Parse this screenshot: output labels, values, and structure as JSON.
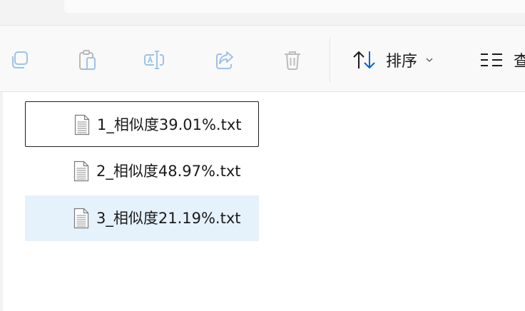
{
  "toolbar": {
    "buttons": [
      {
        "name": "copy-button",
        "icon": "copy-icon"
      },
      {
        "name": "paste-button",
        "icon": "paste-icon"
      },
      {
        "name": "rename-button",
        "icon": "rename-icon"
      },
      {
        "name": "share-button",
        "icon": "share-icon"
      },
      {
        "name": "delete-button",
        "icon": "trash-icon"
      }
    ],
    "sort_label": "排序",
    "view_label": "查"
  },
  "files": [
    {
      "name": "1_相似度39.01%.txt",
      "state": "focused"
    },
    {
      "name": "2_相似度48.97%.txt",
      "state": "normal"
    },
    {
      "name": "3_相似度21.19%.txt",
      "state": "selected"
    }
  ],
  "colors": {
    "toolbar_bg": "#f9f9f9",
    "disabled_icon": "#9ec3e6",
    "selected_row": "#e5f1fb",
    "accent": "#0067c0"
  }
}
